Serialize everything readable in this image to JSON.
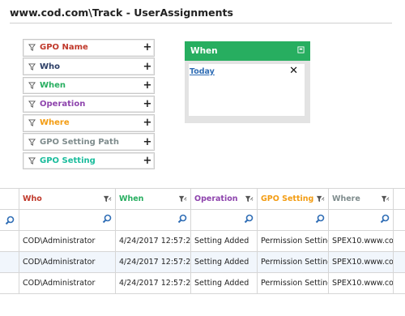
{
  "header": {
    "title": "www.cod.com\\Track - UserAssignments"
  },
  "filters": [
    {
      "label": "GPO Name",
      "color": "#c0392b"
    },
    {
      "label": "Who",
      "color": "#2c3e66"
    },
    {
      "label": "When",
      "color": "#27ae60"
    },
    {
      "label": "Operation",
      "color": "#8e44ad"
    },
    {
      "label": "Where",
      "color": "#f39c12"
    },
    {
      "label": "GPO Setting Path",
      "color": "#7f8c8d"
    },
    {
      "label": "GPO Setting",
      "color": "#1abc9c"
    }
  ],
  "when_panel": {
    "title": "When",
    "selected": "Today"
  },
  "grid": {
    "columns": [
      {
        "label": "Who",
        "color": "#c0392b"
      },
      {
        "label": "When",
        "color": "#27ae60"
      },
      {
        "label": "Operation",
        "color": "#8e44ad"
      },
      {
        "label": "GPO Setting",
        "color": "#f39c12"
      },
      {
        "label": "Where",
        "color": "#7f8c8d"
      }
    ],
    "rows": [
      [
        "COD\\Administrator",
        "4/24/2017 12:57:2...",
        "Setting Added",
        "Permission Setting",
        "SPEX10.www.co..."
      ],
      [
        "COD\\Administrator",
        "4/24/2017 12:57:2...",
        "Setting Added",
        "Permission Setting",
        "SPEX10.www.co..."
      ],
      [
        "COD\\Administrator",
        "4/24/2017 12:57:2...",
        "Setting Added",
        "Permission Setting",
        "SPEX10.www.co..."
      ]
    ]
  },
  "icons": {
    "filter": "filter-icon",
    "search": "search-icon",
    "add": "plus-icon",
    "close": "close-icon",
    "maximize": "maximize-icon"
  }
}
